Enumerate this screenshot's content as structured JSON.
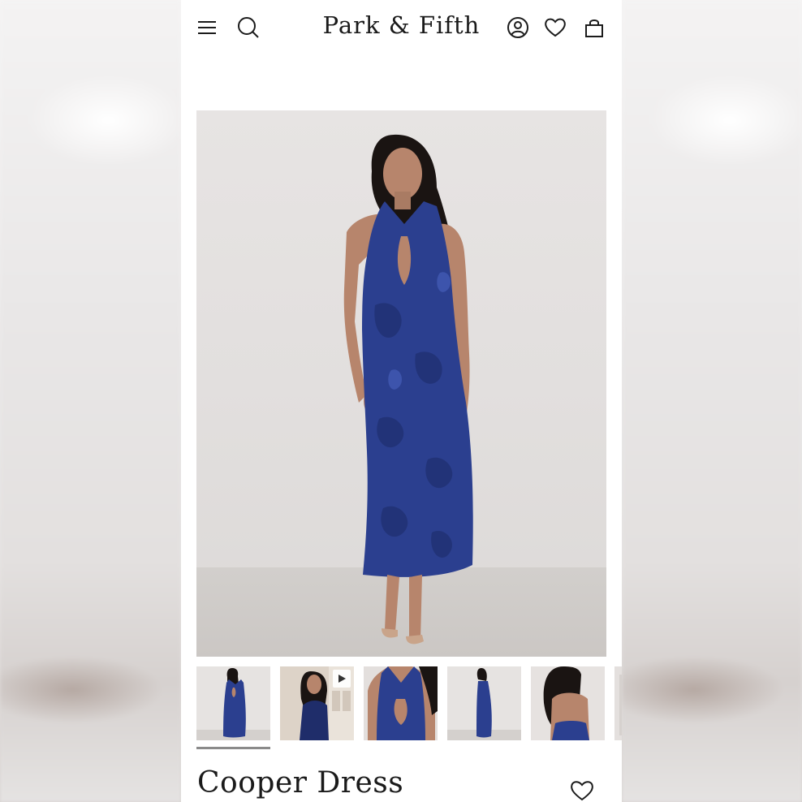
{
  "header": {
    "logo": "Park & Fifth",
    "icons": [
      "menu-icon",
      "search-icon",
      "account-icon",
      "wishlist-icon",
      "cart-icon"
    ]
  },
  "product": {
    "title": "Cooper Dress",
    "thumbnails": [
      "front-full",
      "video",
      "front-detail",
      "side-full",
      "back-detail",
      "more"
    ],
    "active_thumbnail": 0
  },
  "colors": {
    "dress": "#2b3f8f",
    "background": "#ffffff",
    "text": "#1a1a1a"
  }
}
